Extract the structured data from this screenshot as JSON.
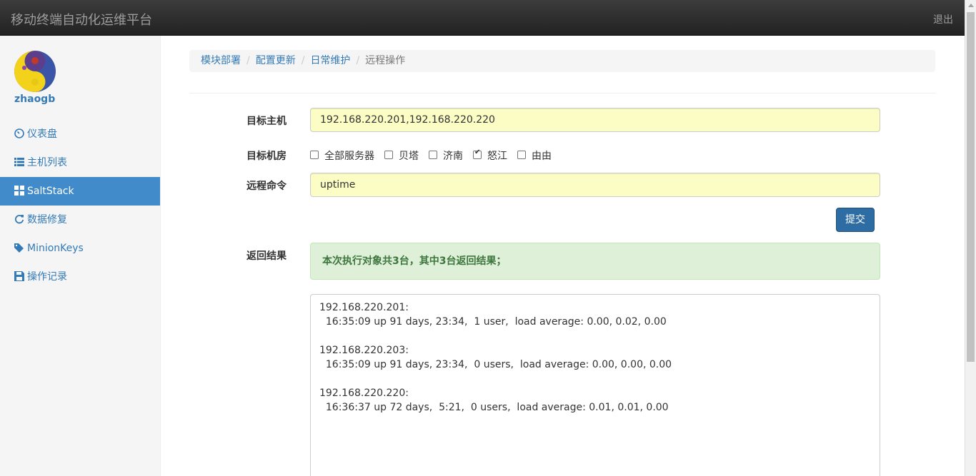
{
  "header": {
    "title": "移动终端自动化运维平台",
    "logout": "退出"
  },
  "sidebar": {
    "username": "zhaogb",
    "items": [
      {
        "label": "仪表盘",
        "icon": "dashboard-icon"
      },
      {
        "label": "主机列表",
        "icon": "list-icon"
      },
      {
        "label": "SaltStack",
        "icon": "grid-icon",
        "active": true
      },
      {
        "label": "数据修复",
        "icon": "refresh-icon"
      },
      {
        "label": "MinionKeys",
        "icon": "tags-icon"
      },
      {
        "label": "操作记录",
        "icon": "save-icon"
      }
    ]
  },
  "breadcrumb": [
    "模块部署",
    "配置更新",
    "日常维护",
    "远程操作"
  ],
  "form": {
    "target_host_label": "目标主机",
    "target_host_value": "192.168.220.201,192.168.220.220",
    "target_room_label": "目标机房",
    "rooms": [
      {
        "label": "全部服务器",
        "checked": false
      },
      {
        "label": "贝塔",
        "checked": false
      },
      {
        "label": "济南",
        "checked": false
      },
      {
        "label": "怒江",
        "checked": true
      },
      {
        "label": "由由",
        "checked": false
      }
    ],
    "command_label": "远程命令",
    "command_value": "uptime",
    "submit_label": "提交"
  },
  "result": {
    "label": "返回结果",
    "summary": "本次执行对象共3台，其中3台返回结果；",
    "lines": [
      "192.168.220.201:",
      "  16:35:09 up 91 days, 23:34,  1 user,  load average: 0.00, 0.02, 0.00",
      "",
      "192.168.220.203:",
      "  16:35:09 up 91 days, 23:34,  0 users,  load average: 0.00, 0.00, 0.00",
      "",
      "192.168.220.220:",
      "  16:36:37 up 72 days,  5:21,  0 users,  load average: 0.01, 0.01, 0.00"
    ]
  },
  "colors": {
    "accent": "#428bca",
    "input_bg": "#fbfdc4",
    "alert_bg": "#dff0d8",
    "alert_text": "#3c763d"
  }
}
